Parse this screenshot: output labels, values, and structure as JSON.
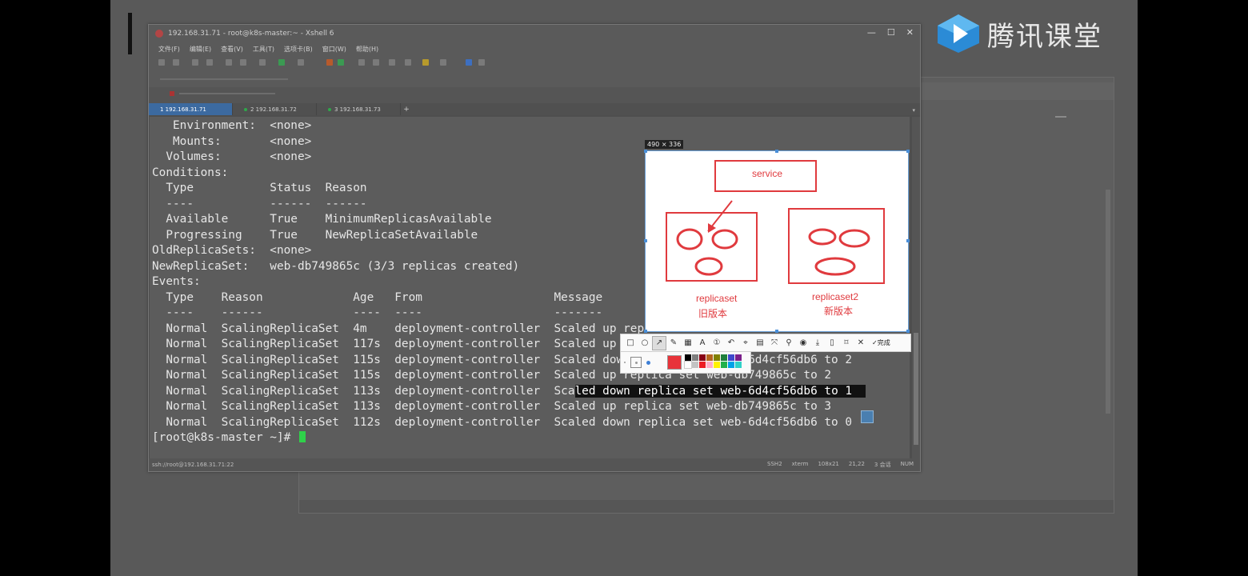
{
  "logo": {
    "text": "腾讯课堂"
  },
  "window": {
    "title": "192.168.31.71 - root@k8s-master:~ - Xshell 6",
    "controls": [
      "—",
      "☐",
      "✕"
    ],
    "menu": [
      "文件(F)",
      "编辑(E)",
      "查看(V)",
      "工具(T)",
      "选项卡(B)",
      "窗口(W)",
      "帮助(H)"
    ],
    "tabs": [
      {
        "label": "1 192.168.31.71",
        "active": true
      },
      {
        "label": "2 192.168.31.72",
        "active": false
      },
      {
        "label": "3 192.168.31.73",
        "active": false
      }
    ],
    "tab_add": "+",
    "status_left": "ssh://root@192.168.31.71:22",
    "status_right": [
      "SSH2",
      "xterm",
      "108x21",
      "21,22",
      "3 会话",
      "NUM"
    ]
  },
  "terminal": {
    "lines": [
      "   Environment:  <none>",
      "   Mounts:       <none>",
      "  Volumes:       <none>",
      "Conditions:",
      "  Type           Status  Reason",
      "  ----           ------  ------",
      "  Available      True    MinimumReplicasAvailable",
      "  Progressing    True    NewReplicaSetAvailable",
      "OldReplicaSets:  <none>",
      "NewReplicaSet:   web-db749865c (3/3 replicas created)",
      "Events:",
      "  Type    Reason             Age   From                   Message",
      "  ----    ------             ----  ----                   -------",
      "  Normal  ScalingReplicaSet  4m    deployment-controller  Scaled up replica set web-6d4cf56db6 to 3",
      "  Normal  ScalingReplicaSet  117s  deployment-controller  Scaled up replica set web-db749865c to 1",
      "  Normal  ScalingReplicaSet  115s  deployment-controller  Scaled down replica set web-6d4cf56db6 to 2",
      "  Normal  ScalingReplicaSet  115s  deployment-controller  Scaled up replica set web-db749865c to 2"
    ],
    "highlight_prefix": "  Normal  ScalingReplicaSet  113s  deployment-controller  Sca",
    "highlight_text": "led down replica set web-6d4cf56db6 to 1  ",
    "lines_after": [
      "  Normal  ScalingReplicaSet  113s  deployment-controller  Scaled up replica set web-db749865c to 3",
      "  Normal  ScalingReplicaSet  112s  deployment-controller  Scaled down replica set web-6d4cf56db6 to 0"
    ],
    "prompt": "[root@k8s-master ~]# "
  },
  "snip": {
    "size_label": "490 × 336",
    "service_label": "service",
    "replicaset_old_label": "replicaset",
    "replicaset_old_sub": "旧版本",
    "replicaset_new_label": "replicaset2",
    "replicaset_new_sub": "新版本",
    "accent_color": "#e03a3e"
  },
  "annotation": {
    "done_label": "完成",
    "tools": [
      "rect-icon",
      "ellipse-icon",
      "arrow-icon",
      "pen-icon",
      "mosaic-icon",
      "text-icon",
      "number-icon",
      "undo-icon",
      "pin-icon",
      "ocr-icon",
      "screenshot-scroll-icon",
      "pin2-icon",
      "record-icon",
      "download-icon",
      "phone-icon",
      "bookmark-icon",
      "close-icon"
    ]
  }
}
